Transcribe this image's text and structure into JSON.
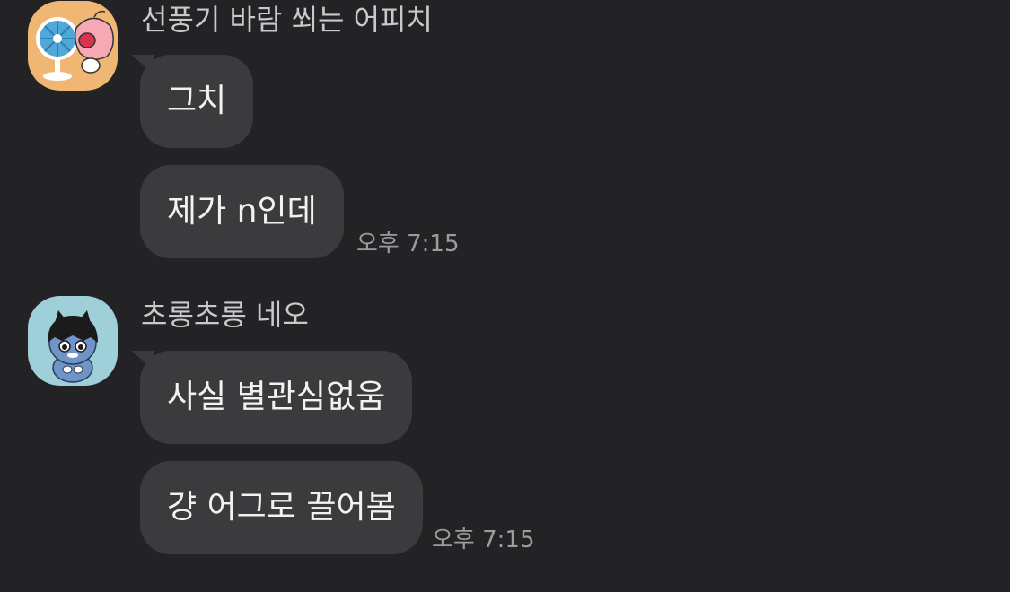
{
  "messages": [
    {
      "sender": "선풍기 바람 쐬는 어피치",
      "avatar_icon": "apeach-fan-icon",
      "avatar_bg": "#f0b774",
      "bubbles": [
        "그치",
        "제가 n인데"
      ],
      "time": "오후 7:15"
    },
    {
      "sender": "초롱초롱 네오",
      "avatar_icon": "neo-character-icon",
      "avatar_bg": "#9fcfd8",
      "bubbles": [
        "사실 별관심없움",
        "걍 어그로 끌어봄"
      ],
      "time": "오후 7:15"
    }
  ],
  "colors": {
    "background": "#232325",
    "bubble": "#3b3b3d",
    "sender_text": "#c9c9cb",
    "message_text": "#f2f2f2",
    "time_text": "#9c9c9e"
  }
}
